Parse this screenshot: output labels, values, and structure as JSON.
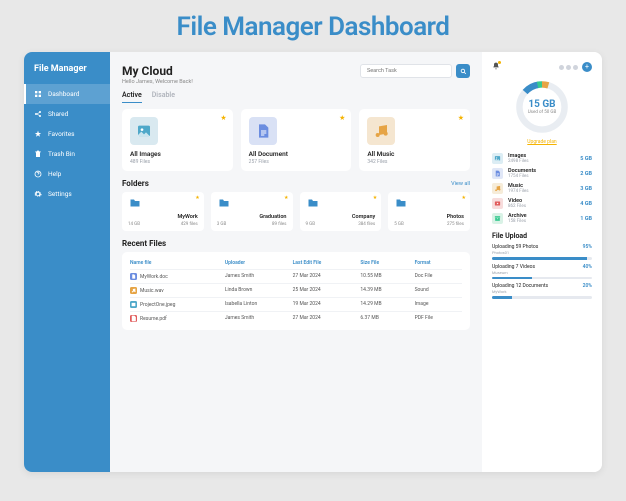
{
  "banner_title": "File Manager Dashboard",
  "brand": "File Manager",
  "nav": [
    {
      "icon": "grid",
      "label": "Dashboard",
      "active": true
    },
    {
      "icon": "share",
      "label": "Shared",
      "active": false
    },
    {
      "icon": "star",
      "label": "Favorites",
      "active": false
    },
    {
      "icon": "trash",
      "label": "Trash Bin",
      "active": false
    },
    {
      "icon": "help",
      "label": "Help",
      "active": false
    },
    {
      "icon": "gear",
      "label": "Settings",
      "active": false
    }
  ],
  "header": {
    "title": "My Cloud",
    "greeting": "Hello James, Welcome Back!",
    "search_placeholder": "Search Task"
  },
  "tabs": [
    "Active",
    "Disable"
  ],
  "active_tab": 0,
  "cards": [
    {
      "icon": "image",
      "name": "All Images",
      "sub": "489 Files",
      "color": "#4fa8c9"
    },
    {
      "icon": "doc",
      "name": "All Document",
      "sub": "257 Files",
      "color": "#6b8de0"
    },
    {
      "icon": "music",
      "name": "All Music",
      "sub": "342 Files",
      "color": "#e6a445"
    }
  ],
  "folders_title": "Folders",
  "view_all": "View all",
  "folders": [
    {
      "name": "MyWork",
      "size": "14 GB",
      "files": "429 files"
    },
    {
      "name": "Graduation",
      "size": "3 GB",
      "files": "89 files"
    },
    {
      "name": "Company",
      "size": "9 GB",
      "files": "384 files"
    },
    {
      "name": "Photos",
      "size": "5 GB",
      "files": "275 files"
    }
  ],
  "recent_title": "Recent Files",
  "table_headers": [
    "Name file",
    "Uploader",
    "Last Edit File",
    "Size File",
    "Format"
  ],
  "recent": [
    {
      "icon": "doc",
      "name": "MyWork.doc",
      "uploader": "James Smith",
      "date": "27 Mar 2024",
      "size": "10.55 MB",
      "format": "Doc File",
      "color": "#6b8de0"
    },
    {
      "icon": "music",
      "name": "Music.wav",
      "uploader": "Linda Brown",
      "date": "25 Mar 2024",
      "size": "14.39 MB",
      "format": "Sound",
      "color": "#e6a445"
    },
    {
      "icon": "image",
      "name": "ProjectOne.jpeg",
      "uploader": "Isabella Linton",
      "date": "19 Mar 2024",
      "size": "14.29 MB",
      "format": "Image",
      "color": "#4fa8c9"
    },
    {
      "icon": "pdf",
      "name": "Resume.pdf",
      "uploader": "James Smith",
      "date": "27 Mar 2024",
      "size": "6.37 MB",
      "format": "PDF File",
      "color": "#e05a5a"
    }
  ],
  "storage": {
    "used_value": "15 GB",
    "used_label": "Used of 50 GB",
    "upgrade": "Upgrade plan"
  },
  "chart_data": {
    "type": "pie",
    "title": "Storage Usage",
    "series": [
      {
        "name": "Images",
        "value": 5,
        "color": "#4fa8c9"
      },
      {
        "name": "Documents",
        "value": 2,
        "color": "#6b8de0"
      },
      {
        "name": "Music",
        "value": 3,
        "color": "#e6a445"
      },
      {
        "name": "Video",
        "value": 4,
        "color": "#3a8dc8"
      },
      {
        "name": "Archive",
        "value": 1,
        "color": "#36c98f"
      },
      {
        "name": "Free",
        "value": 35,
        "color": "#e9edf2"
      }
    ],
    "total": 50,
    "used": 15,
    "unit": "GB"
  },
  "categories": [
    {
      "icon": "image",
      "name": "Images",
      "sub": "2498 Files",
      "size": "5 GB",
      "bg": "#dcedf4",
      "fg": "#4fa8c9"
    },
    {
      "icon": "doc",
      "name": "Documents",
      "sub": "1754 Files",
      "size": "2 GB",
      "bg": "#e0e7f7",
      "fg": "#6b8de0"
    },
    {
      "icon": "music",
      "name": "Music",
      "sub": "1974 Files",
      "size": "3 GB",
      "bg": "#f6ecd9",
      "fg": "#e6a445"
    },
    {
      "icon": "video",
      "name": "Video",
      "sub": "862 Files",
      "size": "4 GB",
      "bg": "#f7dcdc",
      "fg": "#e05a5a"
    },
    {
      "icon": "archive",
      "name": "Archive",
      "sub": "158 Files",
      "size": "1 GB",
      "bg": "#d9f2e6",
      "fg": "#36c98f"
    }
  ],
  "upload_title": "File Upload",
  "uploads": [
    {
      "label": "Uploading 59 Photos",
      "sub": "Photos01",
      "pct": 95
    },
    {
      "label": "Uploading 7 Videos",
      "sub": "Museum",
      "pct": 40
    },
    {
      "label": "Uploading 12 Documents",
      "sub": "MyWork",
      "pct": 20
    }
  ]
}
